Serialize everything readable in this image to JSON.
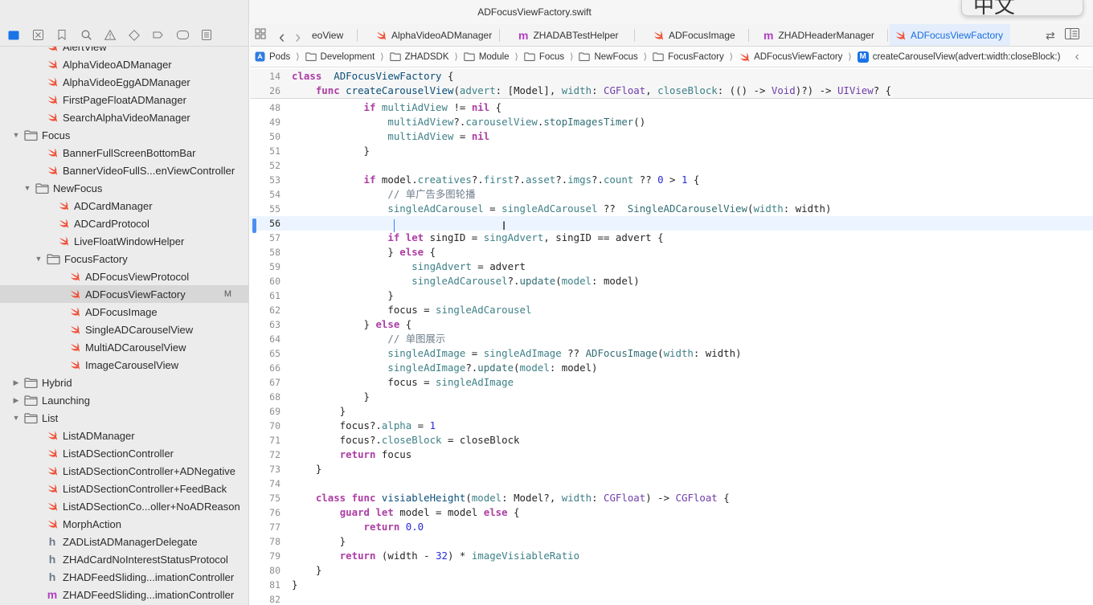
{
  "window": {
    "title": "ADFocusViewFactory.swift",
    "ime_char": "中文"
  },
  "navigator": {
    "toolbar_icons": [
      "folder-icon",
      "x-square-icon",
      "bookmark-icon",
      "search-icon",
      "warning-icon",
      "diamond-icon",
      "breakpoint-icon",
      "tag-icon",
      "report-icon"
    ],
    "rows": [
      {
        "label": "AlertView",
        "type": "swift",
        "indent": 1
      },
      {
        "label": "AlphaVideoADManager",
        "type": "swift",
        "indent": 1
      },
      {
        "label": "AlphaVideoEggADManager",
        "type": "swift",
        "indent": 1
      },
      {
        "label": "FirstPageFloatADManager",
        "type": "swift",
        "indent": 1
      },
      {
        "label": "SearchAlphaVideoManager",
        "type": "swift",
        "indent": 1
      },
      {
        "label": "Focus",
        "type": "folder",
        "indent": 0,
        "expanded": true
      },
      {
        "label": "BannerFullScreenBottomBar",
        "type": "swift",
        "indent": 1
      },
      {
        "label": "BannerVideoFullS...enViewController",
        "type": "swift",
        "indent": 1
      },
      {
        "label": "NewFocus",
        "type": "folder",
        "indent": 1,
        "expanded": true
      },
      {
        "label": "ADCardManager",
        "type": "swift",
        "indent": 2
      },
      {
        "label": "ADCardProtocol",
        "type": "swift",
        "indent": 2
      },
      {
        "label": "LiveFloatWindowHelper",
        "type": "swift",
        "indent": 2
      },
      {
        "label": "FocusFactory",
        "type": "folder",
        "indent": 2,
        "expanded": true
      },
      {
        "label": "ADFocusViewProtocol",
        "type": "swift",
        "indent": 3
      },
      {
        "label": "ADFocusViewFactory",
        "type": "swift",
        "indent": 3,
        "selected": true,
        "badge": "M"
      },
      {
        "label": "ADFocusImage",
        "type": "swift",
        "indent": 3
      },
      {
        "label": "SingleADCarouselView",
        "type": "swift",
        "indent": 3
      },
      {
        "label": "MultiADCarouselView",
        "type": "swift",
        "indent": 3
      },
      {
        "label": "ImageCarouselView",
        "type": "swift",
        "indent": 3
      },
      {
        "label": "Hybrid",
        "type": "folder",
        "indent": 0,
        "expanded": false
      },
      {
        "label": "Launching",
        "type": "folder",
        "indent": 0,
        "expanded": false
      },
      {
        "label": "List",
        "type": "folder",
        "indent": 0,
        "expanded": true
      },
      {
        "label": "ListADManager",
        "type": "swift",
        "indent": 1
      },
      {
        "label": "ListADSectionController",
        "type": "swift",
        "indent": 1
      },
      {
        "label": "ListADSectionController+ADNegative",
        "type": "swift",
        "indent": 1
      },
      {
        "label": "ListADSectionController+FeedBack",
        "type": "swift",
        "indent": 1
      },
      {
        "label": "ListADSectionCo...oller+NoADReason",
        "type": "swift",
        "indent": 1
      },
      {
        "label": "MorphAction",
        "type": "swift",
        "indent": 1
      },
      {
        "label": "ZADListADManagerDelegate",
        "type": "h",
        "indent": 1
      },
      {
        "label": "ZHAdCardNoInterestStatusProtocol",
        "type": "h",
        "indent": 1
      },
      {
        "label": "ZHADFeedSliding...imationController",
        "type": "h",
        "indent": 1
      },
      {
        "label": "ZHADFeedSliding...imationController",
        "type": "m",
        "indent": 1
      }
    ]
  },
  "tabs": [
    {
      "label": "eoView",
      "type": "none"
    },
    {
      "label": "AlphaVideoADManager",
      "type": "swift"
    },
    {
      "label": "ZHADABTestHelper",
      "type": "m"
    },
    {
      "label": "ADFocusImage",
      "type": "swift"
    },
    {
      "label": "ZHADHeaderManager",
      "type": "m"
    },
    {
      "label": "ADFocusViewFactory",
      "type": "swift",
      "active": true
    }
  ],
  "jumpbar": [
    {
      "label": "Pods",
      "icon": "app"
    },
    {
      "label": "Development",
      "icon": "folder"
    },
    {
      "label": "ZHADSDK",
      "icon": "folder"
    },
    {
      "label": "Module",
      "icon": "folder"
    },
    {
      "label": "Focus",
      "icon": "folder"
    },
    {
      "label": "NewFocus",
      "icon": "folder"
    },
    {
      "label": "FocusFactory",
      "icon": "folder"
    },
    {
      "label": "ADFocusViewFactory",
      "icon": "swift"
    },
    {
      "label": "createCarouselView(advert:width:closeBlock:)",
      "icon": "method"
    }
  ],
  "editor": {
    "current_line": "56",
    "sticky": [
      {
        "n": "14",
        "code": [
          [
            "kw",
            "class"
          ],
          [
            "",
            "  "
          ],
          [
            "df",
            "ADFocusViewFactory"
          ],
          [
            "",
            " {"
          ]
        ]
      },
      {
        "n": "26",
        "code": [
          [
            "",
            "    "
          ],
          [
            "kw",
            "func"
          ],
          [
            "",
            " "
          ],
          [
            "df",
            "createCarouselView"
          ],
          [
            "",
            "("
          ],
          [
            "pr",
            "advert"
          ],
          [
            "",
            ": ["
          ],
          [
            "",
            "Model"
          ],
          [
            "",
            "], "
          ],
          [
            "pr",
            "width"
          ],
          [
            "",
            ": "
          ],
          [
            "ty",
            "CGFloat"
          ],
          [
            "",
            ", "
          ],
          [
            "pr",
            "closeBlock"
          ],
          [
            "",
            ": (() -> "
          ],
          [
            "ty",
            "Void"
          ],
          [
            "",
            ")?) -> "
          ],
          [
            "ty",
            "UIView"
          ],
          [
            "",
            "? {"
          ]
        ]
      }
    ],
    "lines": [
      {
        "n": "48",
        "code": [
          [
            "",
            "            "
          ],
          [
            "kw",
            "if"
          ],
          [
            "",
            " "
          ],
          [
            "pr",
            "multiAdView"
          ],
          [
            "",
            " != "
          ],
          [
            "kw",
            "nil"
          ],
          [
            "",
            " {"
          ]
        ]
      },
      {
        "n": "49",
        "code": [
          [
            "",
            "                "
          ],
          [
            "pr",
            "multiAdView"
          ],
          [
            "",
            "?."
          ],
          [
            "pr",
            "carouselView"
          ],
          [
            "",
            "."
          ],
          [
            "fn",
            "stopImagesTimer"
          ],
          [
            "",
            "()"
          ]
        ]
      },
      {
        "n": "50",
        "code": [
          [
            "",
            "                "
          ],
          [
            "pr",
            "multiAdView"
          ],
          [
            "",
            " = "
          ],
          [
            "kw",
            "nil"
          ]
        ]
      },
      {
        "n": "51",
        "code": [
          [
            "",
            "            }"
          ]
        ]
      },
      {
        "n": "52",
        "code": []
      },
      {
        "n": "53",
        "code": [
          [
            "",
            "            "
          ],
          [
            "kw",
            "if"
          ],
          [
            "",
            " model."
          ],
          [
            "pr",
            "creatives"
          ],
          [
            "",
            "?."
          ],
          [
            "pr",
            "first"
          ],
          [
            "",
            "?."
          ],
          [
            "pr",
            "asset"
          ],
          [
            "",
            "?."
          ],
          [
            "pr",
            "imgs"
          ],
          [
            "",
            "?."
          ],
          [
            "pr",
            "count"
          ],
          [
            "",
            " ?? "
          ],
          [
            "nm",
            "0"
          ],
          [
            "",
            " > "
          ],
          [
            "nm",
            "1"
          ],
          [
            "",
            " {"
          ]
        ]
      },
      {
        "n": "54",
        "code": [
          [
            "",
            "                "
          ],
          [
            "cm",
            "// 单广告多图轮播"
          ]
        ]
      },
      {
        "n": "55",
        "code": [
          [
            "",
            "                "
          ],
          [
            "pr",
            "singleAdCarousel"
          ],
          [
            "",
            " = "
          ],
          [
            "pr",
            "singleAdCarousel"
          ],
          [
            "",
            " ??  "
          ],
          [
            "fn",
            "SingleADCarouselView"
          ],
          [
            "",
            "("
          ],
          [
            "pr",
            "width"
          ],
          [
            "",
            ": width)"
          ]
        ]
      },
      {
        "n": "56",
        "code": [],
        "current": true
      },
      {
        "n": "57",
        "code": [
          [
            "",
            "                "
          ],
          [
            "kw",
            "if let"
          ],
          [
            "",
            " singID = "
          ],
          [
            "pr",
            "singAdvert"
          ],
          [
            "",
            ", singID == advert {"
          ]
        ]
      },
      {
        "n": "58",
        "code": [
          [
            "",
            "                } "
          ],
          [
            "kw",
            "else"
          ],
          [
            "",
            " {"
          ]
        ]
      },
      {
        "n": "59",
        "code": [
          [
            "",
            "                    "
          ],
          [
            "pr",
            "singAdvert"
          ],
          [
            "",
            " = advert"
          ]
        ]
      },
      {
        "n": "60",
        "code": [
          [
            "",
            "                    "
          ],
          [
            "pr",
            "singleAdCarousel"
          ],
          [
            "",
            "?."
          ],
          [
            "fn",
            "update"
          ],
          [
            "",
            "("
          ],
          [
            "pr",
            "model"
          ],
          [
            "",
            ": model)"
          ]
        ]
      },
      {
        "n": "61",
        "code": [
          [
            "",
            "                }"
          ]
        ]
      },
      {
        "n": "62",
        "code": [
          [
            "",
            "                focus = "
          ],
          [
            "pr",
            "singleAdCarousel"
          ]
        ]
      },
      {
        "n": "63",
        "code": [
          [
            "",
            "            } "
          ],
          [
            "kw",
            "else"
          ],
          [
            "",
            " {"
          ]
        ]
      },
      {
        "n": "64",
        "code": [
          [
            "",
            "                "
          ],
          [
            "cm",
            "// 单图展示"
          ]
        ]
      },
      {
        "n": "65",
        "code": [
          [
            "",
            "                "
          ],
          [
            "pr",
            "singleAdImage"
          ],
          [
            "",
            " = "
          ],
          [
            "pr",
            "singleAdImage"
          ],
          [
            "",
            " ?? "
          ],
          [
            "fn",
            "ADFocusImage"
          ],
          [
            "",
            "("
          ],
          [
            "pr",
            "width"
          ],
          [
            "",
            ": width)"
          ]
        ]
      },
      {
        "n": "66",
        "code": [
          [
            "",
            "                "
          ],
          [
            "pr",
            "singleAdImage"
          ],
          [
            "",
            "?."
          ],
          [
            "fn",
            "update"
          ],
          [
            "",
            "("
          ],
          [
            "pr",
            "model"
          ],
          [
            "",
            ": model)"
          ]
        ]
      },
      {
        "n": "67",
        "code": [
          [
            "",
            "                focus = "
          ],
          [
            "pr",
            "singleAdImage"
          ]
        ]
      },
      {
        "n": "68",
        "code": [
          [
            "",
            "            }"
          ]
        ]
      },
      {
        "n": "69",
        "code": [
          [
            "",
            "        }"
          ]
        ]
      },
      {
        "n": "70",
        "code": [
          [
            "",
            "        focus?."
          ],
          [
            "pr",
            "alpha"
          ],
          [
            "",
            " = "
          ],
          [
            "nm",
            "1"
          ]
        ]
      },
      {
        "n": "71",
        "code": [
          [
            "",
            "        focus?."
          ],
          [
            "pr",
            "closeBlock"
          ],
          [
            "",
            " = closeBlock"
          ]
        ]
      },
      {
        "n": "72",
        "code": [
          [
            "",
            "        "
          ],
          [
            "kw",
            "return"
          ],
          [
            "",
            " focus"
          ]
        ]
      },
      {
        "n": "73",
        "code": [
          [
            "",
            "    }"
          ]
        ]
      },
      {
        "n": "74",
        "code": []
      },
      {
        "n": "75",
        "code": [
          [
            "",
            "    "
          ],
          [
            "kw",
            "class func"
          ],
          [
            "",
            " "
          ],
          [
            "df",
            "visiableHeight"
          ],
          [
            "",
            "("
          ],
          [
            "pr",
            "model"
          ],
          [
            "",
            ": "
          ],
          [
            "",
            "Model"
          ],
          [
            "",
            "?, "
          ],
          [
            "pr",
            "width"
          ],
          [
            "",
            ": "
          ],
          [
            "ty",
            "CGFloat"
          ],
          [
            "",
            ") -> "
          ],
          [
            "ty",
            "CGFloat"
          ],
          [
            "",
            " {"
          ]
        ]
      },
      {
        "n": "76",
        "code": [
          [
            "",
            "        "
          ],
          [
            "kw",
            "guard let"
          ],
          [
            "",
            " model = model "
          ],
          [
            "kw",
            "else"
          ],
          [
            "",
            " {"
          ]
        ]
      },
      {
        "n": "77",
        "code": [
          [
            "",
            "            "
          ],
          [
            "kw",
            "return"
          ],
          [
            "",
            " "
          ],
          [
            "nm",
            "0.0"
          ]
        ]
      },
      {
        "n": "78",
        "code": [
          [
            "",
            "        }"
          ]
        ]
      },
      {
        "n": "79",
        "code": [
          [
            "",
            "        "
          ],
          [
            "kw",
            "return"
          ],
          [
            "",
            " (width - "
          ],
          [
            "nm",
            "32"
          ],
          [
            "",
            ") * "
          ],
          [
            "pr",
            "imageVisiableRatio"
          ]
        ]
      },
      {
        "n": "80",
        "code": [
          [
            "",
            "    }"
          ]
        ]
      },
      {
        "n": "81",
        "code": [
          [
            "",
            "}"
          ]
        ]
      },
      {
        "n": "82",
        "code": []
      }
    ]
  },
  "colors": {
    "accent": "#1a73e8",
    "swift": "#f05138",
    "keyword": "#ad3da4",
    "comment": "#707f8c",
    "number": "#272ad8"
  }
}
